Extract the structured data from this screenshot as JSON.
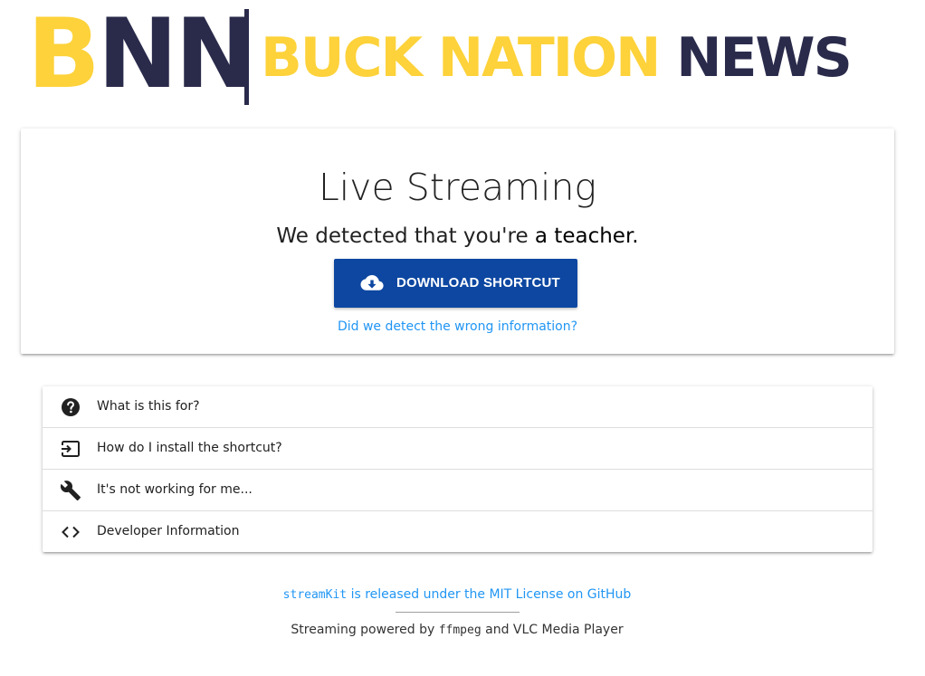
{
  "logo": {
    "initial_b": "B",
    "initial_nn": "NN",
    "word_buck_nation": "BUCK NATION",
    "word_news": "NEWS",
    "gold_color": "#fdd23a",
    "navy_color": "#2a2b4b"
  },
  "card": {
    "title": "Live Streaming",
    "detect_prefix": "We detected that you're",
    "detect_role": "a teacher.",
    "download_label": "DOWNLOAD SHORTCUT",
    "download_icon": "cloud-download-icon",
    "button_color": "#0d47a1",
    "wrong_link": "Did we detect the wrong information?"
  },
  "faq": {
    "items": [
      {
        "label": "What is this for?",
        "icon": "help-circle-icon"
      },
      {
        "label": "How do I install the shortcut?",
        "icon": "input-arrow-icon"
      },
      {
        "label": "It's not working for me...",
        "icon": "wrench-icon"
      },
      {
        "label": "Developer Information",
        "icon": "code-brackets-icon"
      }
    ]
  },
  "footer": {
    "project_name": "streamKit",
    "license_text": " is released under the MIT License on GitHub",
    "powered_prefix": "Streaming powered by ",
    "powered_tool": "ffmpeg",
    "powered_suffix": " and VLC Media Player",
    "link_color": "#2196f3"
  }
}
